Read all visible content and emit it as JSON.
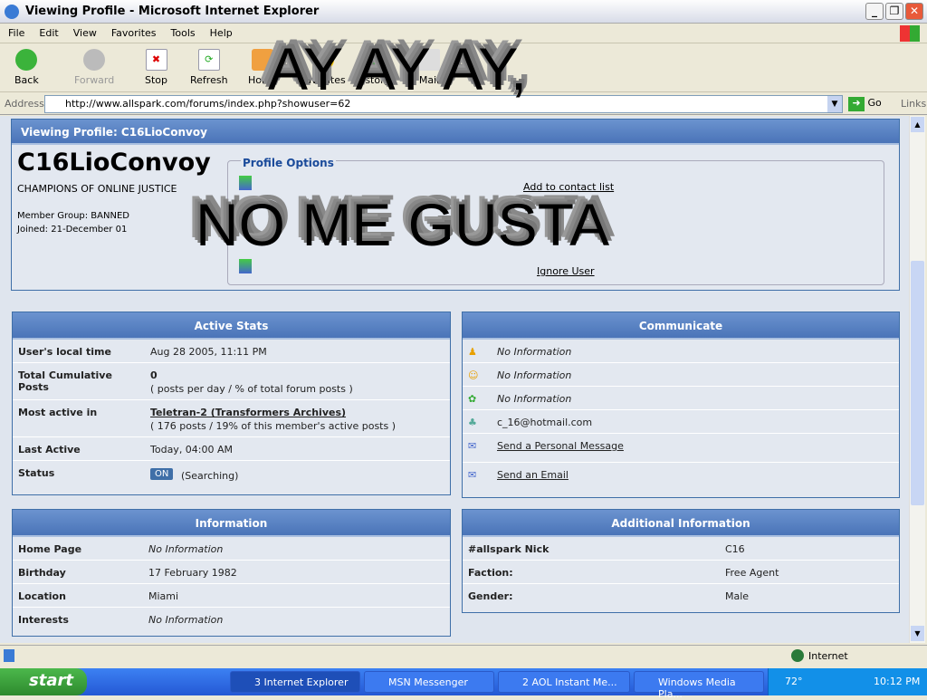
{
  "window": {
    "title": "Viewing Profile - Microsoft Internet Explorer"
  },
  "menu": [
    "File",
    "Edit",
    "View",
    "Favorites",
    "Tools",
    "Help"
  ],
  "toolbar": {
    "back": "Back",
    "forward": "Forward",
    "stop": "Stop",
    "refresh": "Refresh",
    "home": "Home",
    "favorites": "Favorites",
    "history": "History",
    "mail": "Mail"
  },
  "address": {
    "label": "Address",
    "url": "http://www.allspark.com/forums/index.php?showuser=62",
    "go": "Go",
    "links": "Links"
  },
  "profile": {
    "header": "Viewing Profile: C16LioConvoy",
    "name": "C16LioConvoy",
    "tagline": "CHAMPIONS OF ONLINE JUSTICE",
    "group": "Member Group: BANNED",
    "joined": "Joined: 21-December 01",
    "options_title": "Profile Options",
    "options": [
      "Add to contact list",
      "Ignore User"
    ]
  },
  "active_stats": {
    "title": "Active Stats",
    "rows": [
      {
        "k": "User's local time",
        "v": "Aug 28 2005, 11:11 PM"
      },
      {
        "k": "Total Cumulative Posts",
        "v": "0",
        "v2": "( posts per day / % of total forum posts )"
      },
      {
        "k": "Most active in",
        "v": "Teletran-2 (Transformers Archives)",
        "v2": "( 176 posts / 19% of this member's active posts )"
      },
      {
        "k": "Last Active",
        "v": "Today, 04:00 AM"
      },
      {
        "k": "Status",
        "badge": "ON",
        "v": "(Searching)"
      }
    ]
  },
  "communicate": {
    "title": "Communicate",
    "rows": [
      "No Information",
      "No Information",
      "No Information",
      "c_16@hotmail.com",
      "Send a Personal Message",
      "Send an Email"
    ]
  },
  "information": {
    "title": "Information",
    "rows": [
      {
        "k": "Home Page",
        "v": "No Information"
      },
      {
        "k": "Birthday",
        "v": "17 February 1982"
      },
      {
        "k": "Location",
        "v": "Miami"
      },
      {
        "k": "Interests",
        "v": "No Information"
      }
    ]
  },
  "additional": {
    "title": "Additional Information",
    "rows": [
      {
        "k": "#allspark Nick",
        "v": "C16"
      },
      {
        "k": "Faction:",
        "v": "Free Agent"
      },
      {
        "k": "Gender:",
        "v": "Male"
      }
    ]
  },
  "meme": {
    "top": "AY AY AY,",
    "bottom": "NO ME GUSTA"
  },
  "status": {
    "zone": "Internet"
  },
  "taskbar": {
    "start": "start",
    "tasks": [
      "3 Internet Explorer",
      "MSN Messenger",
      "2 AOL Instant Me...",
      "Windows Media Pla..."
    ],
    "temp": "72°",
    "clock": "10:12 PM"
  }
}
